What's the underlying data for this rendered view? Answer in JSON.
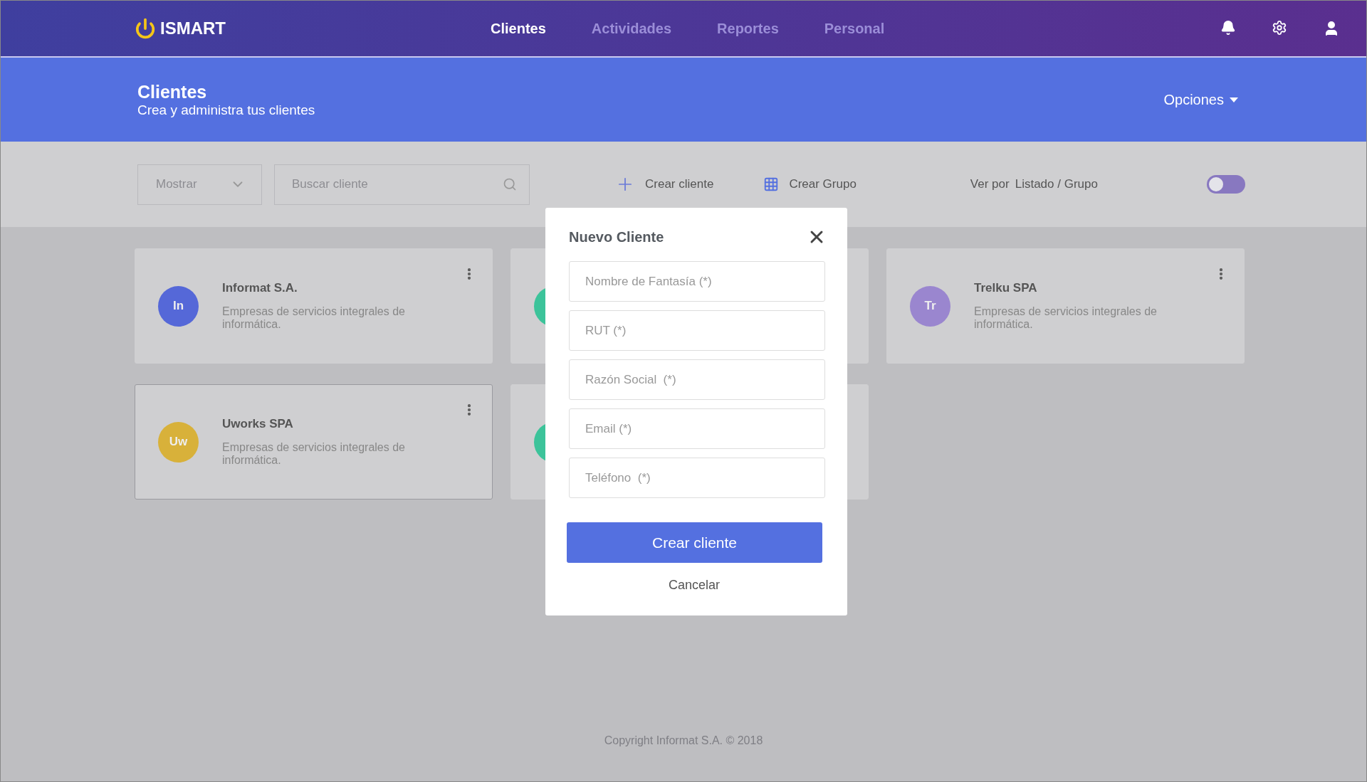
{
  "brand": {
    "name": "ISMART"
  },
  "nav": [
    {
      "label": "Clientes",
      "selected": true
    },
    {
      "label": "Actividades",
      "selected": false
    },
    {
      "label": "Reportes",
      "selected": false
    },
    {
      "label": "Personal",
      "selected": false
    }
  ],
  "banner": {
    "title": "Clientes",
    "subtitle": "Crea y administra tus clientes",
    "options": "Opciones"
  },
  "toolbar": {
    "show": {
      "value": "Mostrar"
    },
    "search": {
      "placeholder": "Buscar cliente"
    },
    "create_client": "Crear cliente",
    "create_group": "Crear Grupo",
    "view_prefix": "Ver por",
    "view_modes": "Listado / Grupo",
    "toggle": {
      "on": false
    }
  },
  "clients": [
    {
      "initials": "In",
      "name": "Informat S.A.",
      "description": "Empresas de servicios integrales de informática.",
      "color": "#5568d8",
      "selected": false
    },
    {
      "color": "#3cc39a",
      "selected": false
    },
    {
      "initials": "Tr",
      "name": "Trelku SPA",
      "description": "Empresas de servicios integrales de informática.",
      "color": "#9a86cf",
      "selected": false
    },
    {
      "initials": "Uw",
      "name": "Uworks SPA",
      "description": "Empresas de servicios integrales de informática.",
      "color": "#d8b13a",
      "selected": true
    },
    {
      "color": "#3cc39a",
      "selected": false
    }
  ],
  "modal": {
    "title": "Nuevo Cliente",
    "fields": [
      {
        "placeholder": "Nombre de Fantasía (*)"
      },
      {
        "placeholder": "RUT (*)"
      },
      {
        "placeholder": "Razón Social  (*)"
      },
      {
        "placeholder": "Email (*)"
      },
      {
        "placeholder": "Teléfono  (*)"
      }
    ],
    "submit": "Crear cliente",
    "cancel": "Cancelar"
  },
  "footer": "Copyright Informat S.A. © 2018"
}
